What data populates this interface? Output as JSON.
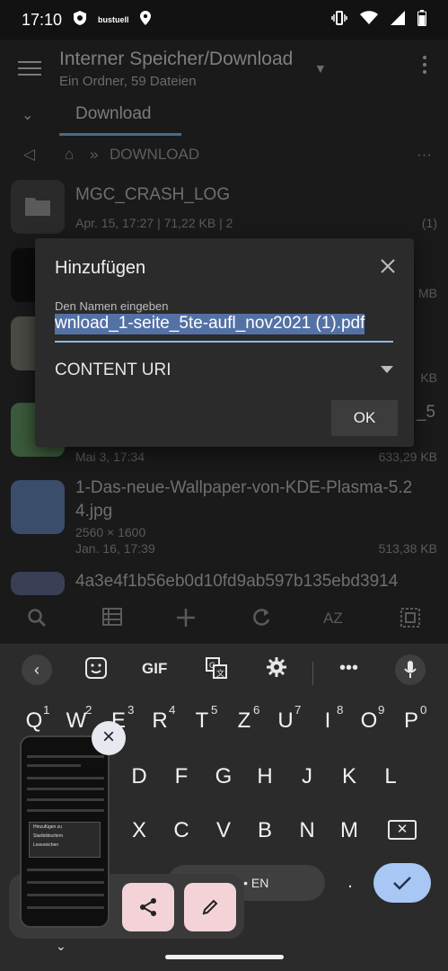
{
  "status": {
    "time": "17:10",
    "badge": "bustuell"
  },
  "appbar": {
    "title": "Interner Speicher/Download",
    "subtitle": "Ein Ordner, 59 Dateien"
  },
  "tab": {
    "label": "Download"
  },
  "breadcrumb": {
    "sep": "»",
    "folder": "DOWNLOAD"
  },
  "files": [
    {
      "name": "MGC_CRASH_LOG",
      "meta": "Apr. 15, 17:27 | 71,22  KB | 2",
      "meta_right": "(1)"
    },
    {
      "name": "",
      "meta": "",
      "meta_right": "MB"
    },
    {
      "name": "",
      "meta": "",
      "meta_right": "KB"
    },
    {
      "name": "_5",
      "meta": "Mai 3, 17:34",
      "meta_right": "633,29  KB"
    },
    {
      "name": "1-Das-neue-Wallpaper-von-KDE-Plasma-5.2",
      "name2": "4.jpg",
      "meta": "2560 × 1600",
      "meta2": "Jan. 16, 17:39",
      "meta_right": "513,38  KB"
    },
    {
      "name": "4a3e4f1b56eb0d10fd9ab597b135ebd3914"
    }
  ],
  "bottombar": {
    "sort": "AZ"
  },
  "dialog": {
    "title": "Hinzufügen",
    "label": "Den Namen eingeben",
    "value": "wnload_1-seite_5te-aufl_nov2021 (1).pdf",
    "select_value": "CONTENT URI",
    "ok": "OK"
  },
  "keyboard": {
    "toolbar": {
      "gif": "GIF"
    },
    "row1": [
      {
        "k": "Q",
        "n": "1"
      },
      {
        "k": "W",
        "n": "2"
      },
      {
        "k": "E",
        "n": "3"
      },
      {
        "k": "R",
        "n": "4"
      },
      {
        "k": "T",
        "n": "5"
      },
      {
        "k": "Z",
        "n": "6"
      },
      {
        "k": "U",
        "n": "7"
      },
      {
        "k": "I",
        "n": "8"
      },
      {
        "k": "O",
        "n": "9"
      },
      {
        "k": "P",
        "n": "0"
      }
    ],
    "row2": [
      "D",
      "F",
      "G",
      "H",
      "J",
      "K",
      "L"
    ],
    "row3": [
      "X",
      "C",
      "V",
      "B",
      "N",
      "M"
    ],
    "space_label": "TR • EN",
    "period": "."
  },
  "preview": {
    "popup_items": [
      "Hinzufügen zu",
      "Startbildschirm",
      "Lesezeichen"
    ]
  },
  "colors": {
    "accent": "#a9c7f5",
    "selection": "#5471a5",
    "preview_button": "#f3d3d8"
  }
}
